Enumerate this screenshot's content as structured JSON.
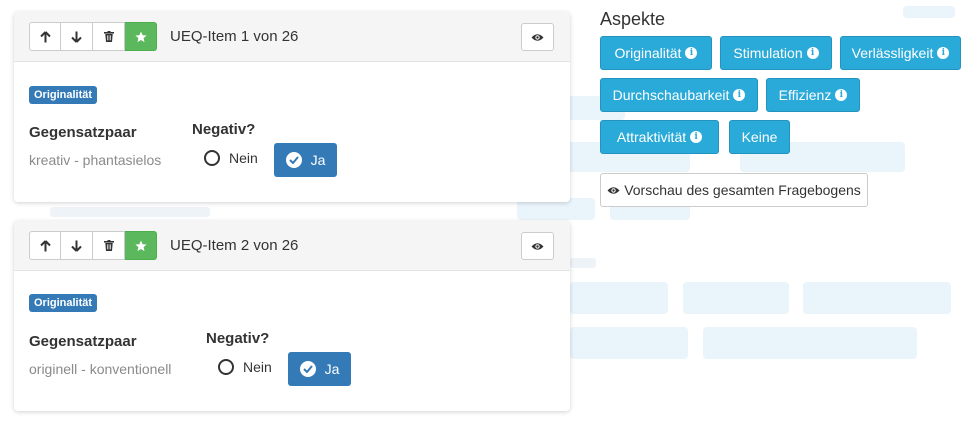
{
  "items": [
    {
      "title": "UEQ-Item 1 von 26",
      "badge": "Originalität",
      "pair_label": "Gegensatzpaar",
      "pair_value": "kreativ - phantasielos",
      "negativ_label": "Negativ?",
      "nein_label": "Nein",
      "ja_label": "Ja"
    },
    {
      "title": "UEQ-Item 2 von 26",
      "badge": "Originalität",
      "pair_label": "Gegensatzpaar",
      "pair_value": "originell - konventionell",
      "negativ_label": "Negativ?",
      "nein_label": "Nein",
      "ja_label": "Ja"
    }
  ],
  "aspekte": {
    "title": "Aspekte",
    "buttons": [
      "Originalität",
      "Stimulation",
      "Verlässligkeit",
      "Durchschaubarkeit",
      "Effizienz",
      "Attraktivität",
      "Keine"
    ],
    "preview_label": "Vorschau des gesamten Fragebogens"
  },
  "icons": {
    "up": "arrow-up-icon",
    "down": "arrow-down-icon",
    "delete": "trash-icon",
    "star": "star-icon",
    "eye": "eye-icon",
    "check": "check-circle-icon",
    "info": "info-circle-icon"
  },
  "colors": {
    "primary": "#337ab7",
    "aspect": "#2aaad8",
    "success": "#5cb85c"
  }
}
